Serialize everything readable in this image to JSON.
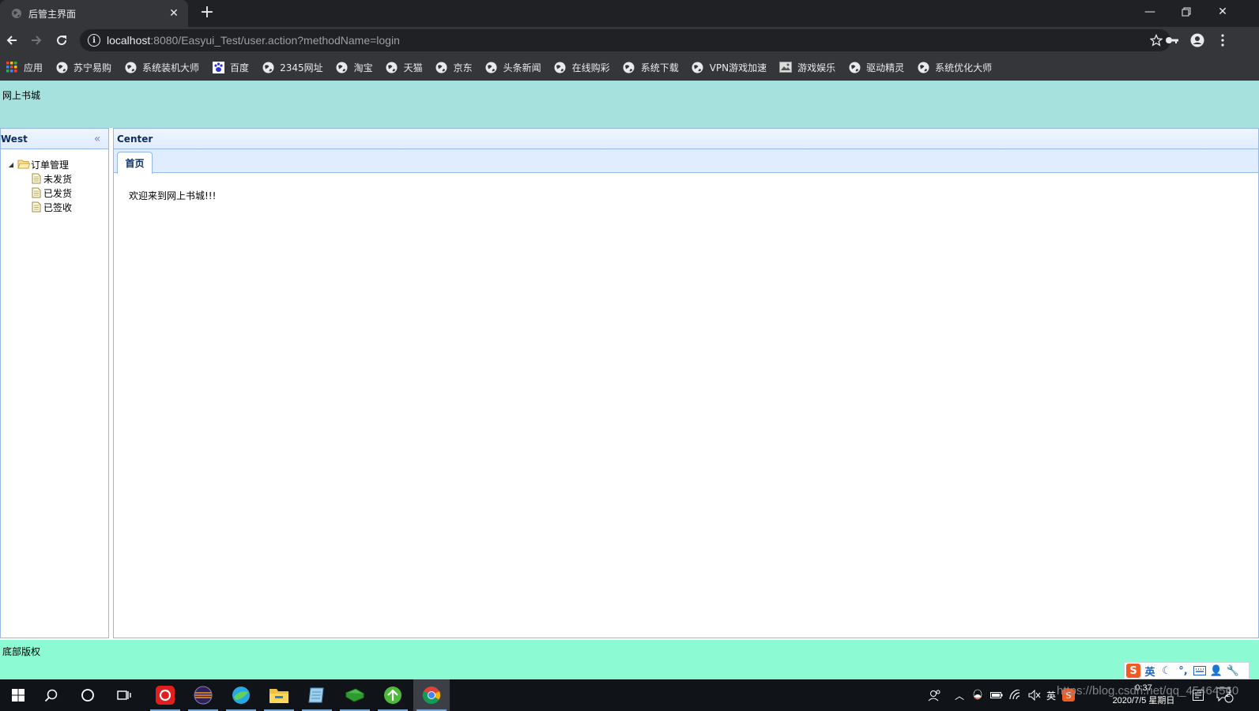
{
  "browser": {
    "tab_title": "后管主界面",
    "url_host": "localhost",
    "url_rest": ":8080/Easyui_Test/user.action?methodName=login",
    "bookmarks": [
      {
        "label": "应用",
        "icon": "apps-grid-icon"
      },
      {
        "label": "苏宁易购",
        "icon": "globe-icon"
      },
      {
        "label": "系统装机大师",
        "icon": "globe-icon"
      },
      {
        "label": "百度",
        "icon": "baidu-paw-icon"
      },
      {
        "label": "2345网址",
        "icon": "globe-icon"
      },
      {
        "label": "淘宝",
        "icon": "globe-icon"
      },
      {
        "label": "天猫",
        "icon": "globe-icon"
      },
      {
        "label": "京东",
        "icon": "globe-icon"
      },
      {
        "label": "头条新闻",
        "icon": "globe-icon"
      },
      {
        "label": "在线购彩",
        "icon": "globe-icon"
      },
      {
        "label": "系统下载",
        "icon": "globe-icon"
      },
      {
        "label": "VPN游戏加速",
        "icon": "globe-icon"
      },
      {
        "label": "游戏娱乐",
        "icon": "image-icon"
      },
      {
        "label": "驱动精灵",
        "icon": "globe-icon"
      },
      {
        "label": "系统优化大师",
        "icon": "globe-icon"
      }
    ]
  },
  "layout": {
    "north_text": "网上书城",
    "south_text": "底部版权",
    "west_title": "West",
    "center_title": "Center"
  },
  "tree": {
    "root_label": "订单管理",
    "children": [
      "未发货",
      "已发货",
      "已签收"
    ]
  },
  "tabs": {
    "active_tab": "首页",
    "content": "欢迎来到网上书城!!!"
  },
  "ime": {
    "mode": "英"
  },
  "taskbar": {
    "tray_lang": "英",
    "time": "0:37",
    "date": "2020/7/5 星期日",
    "notification_count": "2"
  },
  "watermark": "https://blog.csdn.net/qq_45464560",
  "colors": {
    "north_bg": "#a6e1dd",
    "south_bg": "#8cfbd3",
    "panel_border": "#95b8e7",
    "panel_header": "#e0ecff",
    "chrome_dark": "#202124",
    "chrome_toolbar": "#35363a"
  }
}
